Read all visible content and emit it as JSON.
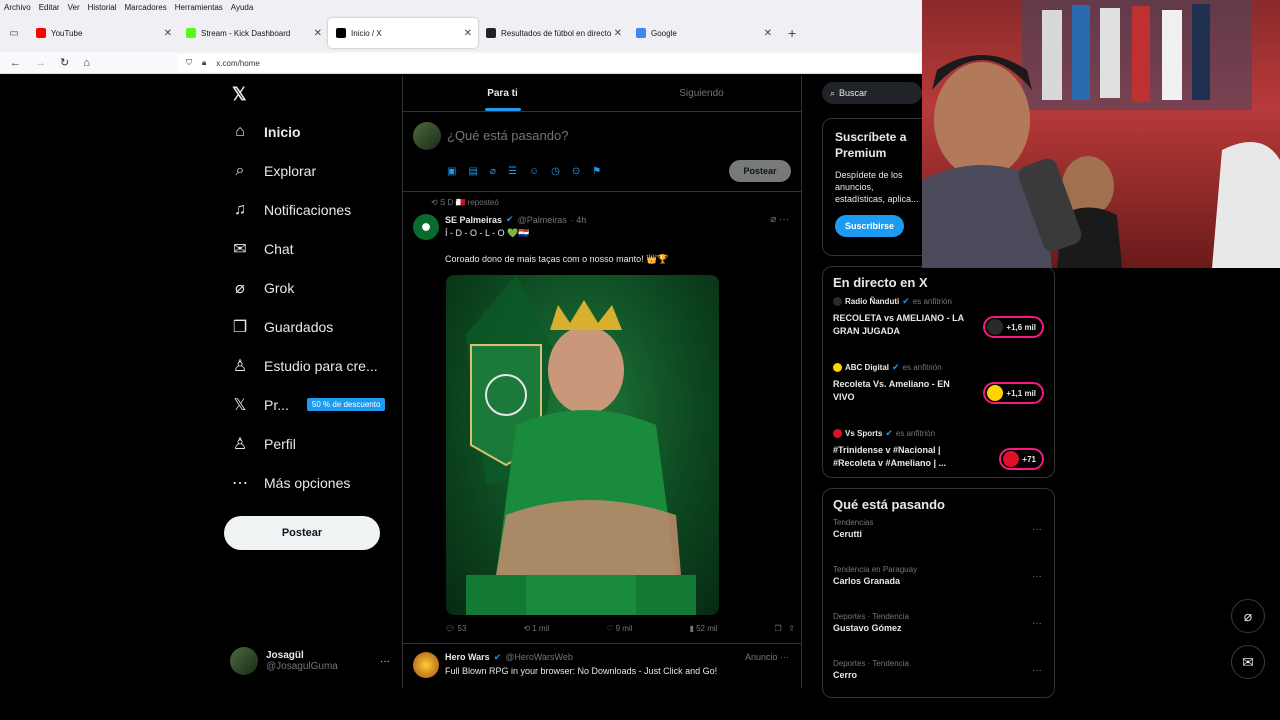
{
  "browser": {
    "menu": [
      "Archivo",
      "Editar",
      "Ver",
      "Historial",
      "Marcadores",
      "Herramientas",
      "Ayuda"
    ],
    "tabs": [
      {
        "title": "YouTube",
        "favicon_color": "#ff0000",
        "active": false
      },
      {
        "title": "Stream - Kick Dashboard",
        "favicon_color": "#53fc18",
        "active": false
      },
      {
        "title": "Inicio / X",
        "favicon_color": "#000000",
        "active": true
      },
      {
        "title": "Resultados de fútbol en directo",
        "favicon_color": "#222222",
        "active": false
      },
      {
        "title": "Google",
        "favicon_color": "#4285f4",
        "active": false
      }
    ],
    "url": "x.com/home"
  },
  "nav": {
    "items": [
      {
        "label": "Inicio",
        "icon": "home-icon",
        "glyph": "⌂",
        "active": true
      },
      {
        "label": "Explorar",
        "icon": "search-icon",
        "glyph": "⌕"
      },
      {
        "label": "Notificaciones",
        "icon": "bell-icon",
        "glyph": "♫"
      },
      {
        "label": "Chat",
        "icon": "mail-icon",
        "glyph": "✉"
      },
      {
        "label": "Grok",
        "icon": "grok-icon",
        "glyph": "⌀"
      },
      {
        "label": "Guardados",
        "icon": "bookmark-icon",
        "glyph": "❒"
      },
      {
        "label": "Estudio para cre...",
        "icon": "studio-icon",
        "glyph": "♙"
      },
      {
        "label": "Pr...",
        "icon": "x-premium-icon",
        "glyph": "𝕏",
        "badge": "50 % de descuento"
      },
      {
        "label": "Perfil",
        "icon": "person-icon",
        "glyph": "♙"
      },
      {
        "label": "Más opciones",
        "icon": "more-circle-icon",
        "glyph": "⋯"
      }
    ],
    "post_label": "Postear",
    "profile": {
      "name": "Josagül",
      "handle": "@JosagulGuma"
    }
  },
  "feed": {
    "tabs": [
      "Para ti",
      "Siguiendo"
    ],
    "composer_placeholder": "¿Qué está pasando?",
    "composer_post": "Postear",
    "tweet": {
      "repost_by": "S D 🇲🇹 reposteó",
      "author": "SE Palmeiras",
      "handle": "@Palmeiras",
      "time": "· 4h",
      "line1": "Í - D - O - L - O 💚🇵🇾",
      "line2": "Coroado dono de mais taças com o nosso manto! 👑🏆",
      "replies": "53",
      "reposts": "1 mil",
      "likes": "9 mil",
      "views": "52 mil"
    },
    "ad": {
      "author": "Hero Wars",
      "handle": "@HeroWarsWeb",
      "label": "Anuncio",
      "text": "Full Blown RPG in your browser: No Downloads - Just Click and Go!"
    }
  },
  "right": {
    "search_placeholder": "Buscar",
    "premium": {
      "title": "Suscríbete a Premium",
      "text": "Despídete de los anuncios, estadísticas, aplica... aprovecha más de...",
      "button": "Suscribirse"
    },
    "live": {
      "title": "En directo en X",
      "items": [
        {
          "host": "Radio Ñanduti",
          "role": "es anfitrión",
          "title": "RECOLETA vs AMELIANO - LA GRAN JUGADA",
          "count": "+1,6 mil",
          "color": "#2a2a2a"
        },
        {
          "host": "ABC Digital",
          "role": "es anfitrión",
          "title": "Recoleta Vs. Ameliano - EN VIVO",
          "count": "+1,1 mil",
          "color": "#ffd400"
        },
        {
          "host": "Vs Sports",
          "role": "es anfitrión",
          "title": "#Trinidense v #Nacional | #Recoleta v #Ameliano | ...",
          "count": "+71",
          "color": "#e0102a"
        }
      ]
    },
    "trends": {
      "title": "Qué está pasando",
      "items": [
        {
          "category": "Tendencias",
          "name": "Cerutti"
        },
        {
          "category": "Tendencia en Paraguay",
          "name": "Carlos Granada"
        },
        {
          "category": "Deportes · Tendencia",
          "name": "Gustavo Gómez"
        },
        {
          "category": "Deportes · Tendencia",
          "name": "Cerro"
        }
      ]
    }
  }
}
